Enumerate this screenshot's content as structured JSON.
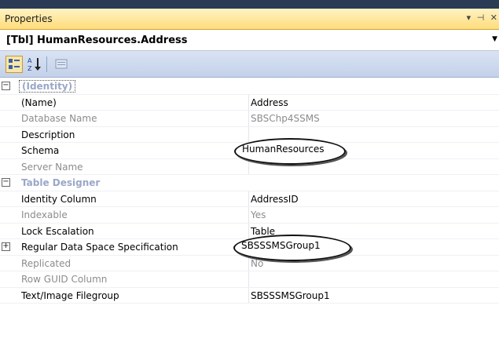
{
  "panel": {
    "title": "Properties",
    "controls": "▾ ⊣ ✕"
  },
  "selector": {
    "text": "[Tbl] HumanResources.Address"
  },
  "toolbar": {
    "categorized": "categorized-icon",
    "alphabetical": "A-Z sort",
    "pages": "property-pages-icon"
  },
  "categories": [
    {
      "label": "(Identity)",
      "rows": [
        {
          "name": "(Name)",
          "value": "Address",
          "readonly": false
        },
        {
          "name": "Database Name",
          "value": "SBSChp4SSMS",
          "readonly": true
        },
        {
          "name": "Description",
          "value": "",
          "readonly": false
        },
        {
          "name": "Schema",
          "value": "HumanResources",
          "readonly": false,
          "highlighted": true
        },
        {
          "name": "Server Name",
          "value": "",
          "readonly": true
        }
      ]
    },
    {
      "label": "Table Designer",
      "rows": [
        {
          "name": "Identity Column",
          "value": "AddressID",
          "readonly": false
        },
        {
          "name": "Indexable",
          "value": "Yes",
          "readonly": true
        },
        {
          "name": "Lock Escalation",
          "value": "Table",
          "readonly": false
        },
        {
          "name": "Regular Data Space Specification",
          "value": "SBSSSMSGroup1",
          "readonly": false,
          "expandable": true,
          "highlighted": true
        },
        {
          "name": "Replicated",
          "value": "No",
          "readonly": true
        },
        {
          "name": "Row GUID Column",
          "value": "",
          "readonly": true
        },
        {
          "name": "Text/Image Filegroup",
          "value": "SBSSSMSGroup1",
          "readonly": false
        }
      ]
    }
  ]
}
